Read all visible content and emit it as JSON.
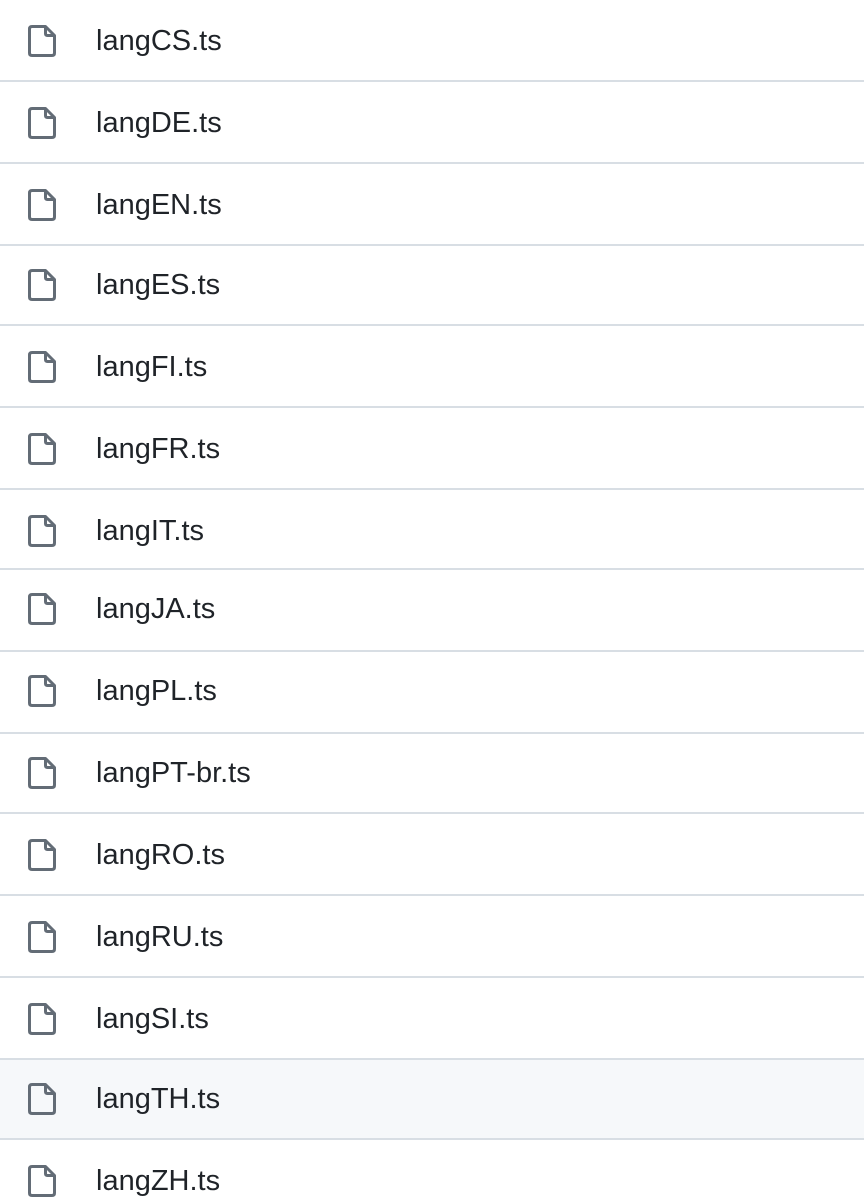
{
  "files": [
    {
      "name": "langCS.ts",
      "icon": "file-icon"
    },
    {
      "name": "langDE.ts",
      "icon": "file-icon"
    },
    {
      "name": "langEN.ts",
      "icon": "file-icon"
    },
    {
      "name": "langES.ts",
      "icon": "file-icon"
    },
    {
      "name": "langFI.ts",
      "icon": "file-icon"
    },
    {
      "name": "langFR.ts",
      "icon": "file-icon"
    },
    {
      "name": "langIT.ts",
      "icon": "file-icon"
    },
    {
      "name": "langJA.ts",
      "icon": "file-icon"
    },
    {
      "name": "langPL.ts",
      "icon": "file-icon"
    },
    {
      "name": "langPT-br.ts",
      "icon": "file-icon"
    },
    {
      "name": "langRO.ts",
      "icon": "file-icon"
    },
    {
      "name": "langRU.ts",
      "icon": "file-icon"
    },
    {
      "name": "langSI.ts",
      "icon": "file-icon"
    },
    {
      "name": "langTH.ts",
      "icon": "file-icon",
      "highlighted": true
    },
    {
      "name": "langZH.ts",
      "icon": "file-icon"
    }
  ],
  "colors": {
    "text": "#1f2328",
    "icon": "#636c76",
    "divider": "#d8dee4",
    "row_hover": "#f6f8fa"
  }
}
